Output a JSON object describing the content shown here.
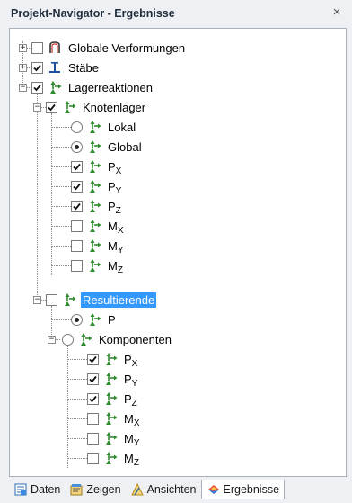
{
  "window": {
    "title": "Projekt-Navigator - Ergebnisse",
    "close_glyph": "×"
  },
  "tree": {
    "globale_verformungen": {
      "label": "Globale Verformungen",
      "expand": "+",
      "checked": false,
      "icon": "deformation-icon"
    },
    "staebe": {
      "label": "Stäbe",
      "expand": "+",
      "checked": true,
      "icon": "member-icon"
    },
    "lagerreaktionen": {
      "label": "Lagerreaktionen",
      "expand": "−",
      "checked": true,
      "icon": "support-reaction-icon"
    },
    "knotenlager": {
      "label": "Knotenlager",
      "expand": "−",
      "checked": true,
      "icon": "support-reaction-icon"
    },
    "lokal": {
      "label": "Lokal",
      "selected": false
    },
    "global": {
      "label": "Global",
      "selected": true
    },
    "components_a": [
      {
        "base": "P",
        "sub": "X",
        "checked": true
      },
      {
        "base": "P",
        "sub": "Y",
        "checked": true
      },
      {
        "base": "P",
        "sub": "Z",
        "checked": true
      },
      {
        "base": "M",
        "sub": "X",
        "checked": false
      },
      {
        "base": "M",
        "sub": "Y",
        "checked": false
      },
      {
        "base": "M",
        "sub": "Z",
        "checked": false
      }
    ],
    "resultierende": {
      "label": "Resultierende",
      "expand": "−",
      "checked": false,
      "highlighted": true
    },
    "p": {
      "label": "P",
      "selected": true
    },
    "komponenten": {
      "label": "Komponenten",
      "expand": "−",
      "selected": false
    },
    "components_b": [
      {
        "base": "P",
        "sub": "X",
        "checked": true
      },
      {
        "base": "P",
        "sub": "Y",
        "checked": true
      },
      {
        "base": "P",
        "sub": "Z",
        "checked": true
      },
      {
        "base": "M",
        "sub": "X",
        "checked": false
      },
      {
        "base": "M",
        "sub": "Y",
        "checked": false
      },
      {
        "base": "M",
        "sub": "Z",
        "checked": false
      }
    ]
  },
  "tabs": [
    {
      "label": "Daten",
      "icon": "data-icon",
      "active": false
    },
    {
      "label": "Zeigen",
      "icon": "display-icon",
      "active": false
    },
    {
      "label": "Ansichten",
      "icon": "views-icon",
      "active": false
    },
    {
      "label": "Ergebnisse",
      "icon": "results-icon",
      "active": true
    }
  ],
  "colors": {
    "selection": "#3399ff",
    "support_icon": "#2e8b2e",
    "member_icon": "#1a4fa0"
  }
}
